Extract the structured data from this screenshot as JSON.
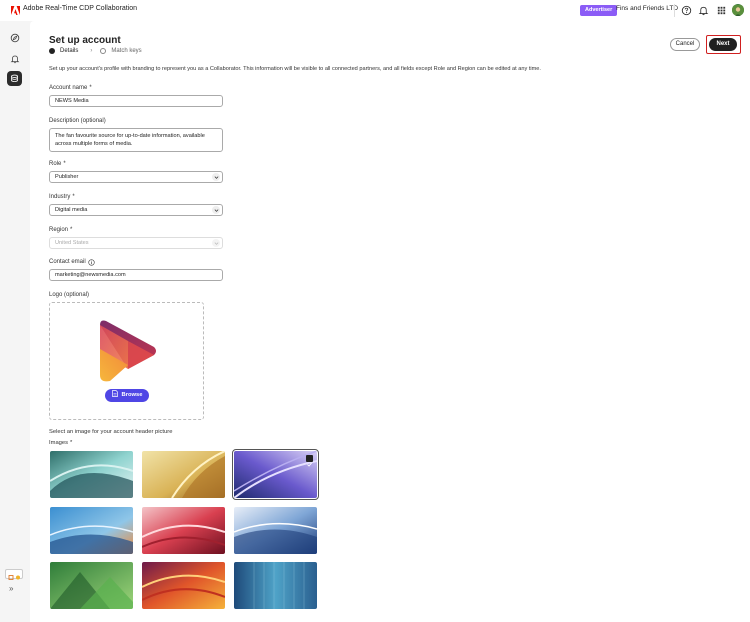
{
  "app": {
    "title": "Adobe Real-Time CDP Collaboration",
    "role_badge": "Advertiser",
    "org_name": "Fins and Friends LTD",
    "icons": [
      "help-icon",
      "bell-icon",
      "apps-grid-icon",
      "avatar"
    ]
  },
  "rail": {
    "items": [
      "compass-icon",
      "bell-icon",
      "database-icon"
    ],
    "active_index": 2
  },
  "page": {
    "title": "Set up account",
    "steps": [
      {
        "label": "Details",
        "state": "current"
      },
      {
        "label": "Match keys",
        "state": "upcoming"
      }
    ],
    "cancel_label": "Cancel",
    "next_label": "Next",
    "intro": "Set up your account's profile with branding to represent you as a Collaborator. This information will be visible to all connected partners, and all fields except Role and Region can be edited at any time."
  },
  "form": {
    "account_name": {
      "label": "Account name",
      "required": "*",
      "value": "NEWS Media"
    },
    "description": {
      "label": "Description (optional)",
      "value_line1": "The fan favourite source for up-to-date information, available",
      "value_line2": "across multiple forms of media."
    },
    "role": {
      "label": "Role",
      "required": "*",
      "value": "Publisher"
    },
    "industry": {
      "label": "Industry",
      "required": "*",
      "value": "Digital media"
    },
    "region": {
      "label": "Region",
      "required": "*",
      "value": "United States"
    },
    "contact_email": {
      "label": "Contact email",
      "value": "marketing@newsmedia.com"
    },
    "logo": {
      "label": "Logo (optional)",
      "browse_label": "Browse"
    },
    "header_caption": "Select an image for your account header picture",
    "images_label": "Images",
    "images_required": "*",
    "selected_image_index": 2
  },
  "colors": {
    "accent": "#4f46e5",
    "badge": "#8b5cf6",
    "next_highlight": "#d02020"
  }
}
